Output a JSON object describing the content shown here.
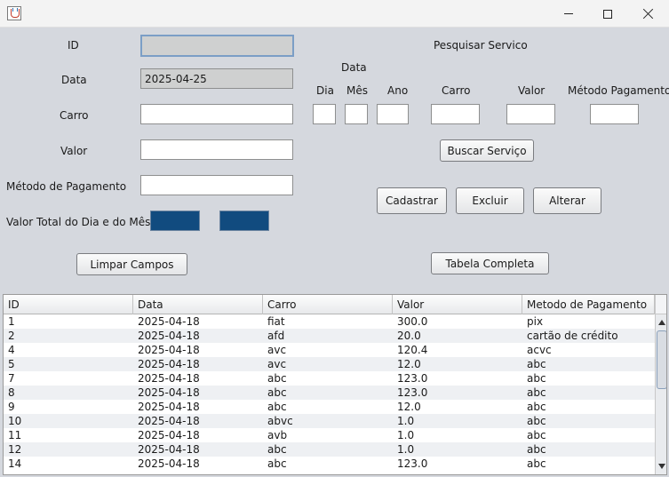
{
  "window": {
    "icon": "java-cup-icon",
    "controls": {
      "minimize": "minimize-icon",
      "maximize": "maximize-icon",
      "close": "close-icon"
    }
  },
  "form": {
    "id_label": "ID",
    "id_value": "",
    "data_label": "Data",
    "data_value": "2025-04-25",
    "carro_label": "Carro",
    "carro_value": "",
    "valor_label": "Valor",
    "valor_value": "",
    "metodo_label": "Método de Pagamento",
    "metodo_value": "",
    "total_label": "Valor Total do Dia e do Mês",
    "total_colors": [
      "#114b7f",
      "#114b7f"
    ]
  },
  "search": {
    "title": "Pesquisar Servico",
    "data_group_label": "Data",
    "dia_label": "Dia",
    "mes_label": "Mês",
    "ano_label": "Ano",
    "carro_label": "Carro",
    "valor_label": "Valor",
    "metodo_label": "Método Pagamento",
    "buscar_button": "Buscar Serviço"
  },
  "buttons": {
    "cadastrar": "Cadastrar",
    "excluir": "Excluir",
    "alterar": "Alterar",
    "limpar": "Limpar Campos",
    "tabela": "Tabela Completa"
  },
  "table": {
    "columns": [
      "ID",
      "Data",
      "Carro",
      "Valor",
      "Metodo de Pagamento"
    ],
    "rows": [
      [
        "1",
        "2025-04-18",
        "fiat",
        "300.0",
        "pix"
      ],
      [
        "2",
        "2025-04-18",
        "afd",
        "20.0",
        "cartão de crédito"
      ],
      [
        "4",
        "2025-04-18",
        "avc",
        "120.4",
        "acvc"
      ],
      [
        "5",
        "2025-04-18",
        "avc",
        "12.0",
        "abc"
      ],
      [
        "7",
        "2025-04-18",
        "abc",
        "123.0",
        "abc"
      ],
      [
        "8",
        "2025-04-18",
        "abc",
        "123.0",
        "abc"
      ],
      [
        "9",
        "2025-04-18",
        "abc",
        "12.0",
        "abc"
      ],
      [
        "10",
        "2025-04-18",
        "abvc",
        "1.0",
        "abc"
      ],
      [
        "11",
        "2025-04-18",
        "avb",
        "1.0",
        "abc"
      ],
      [
        "12",
        "2025-04-18",
        "abc",
        "1.0",
        "abc"
      ],
      [
        "14",
        "2025-04-18",
        "abc",
        "123.0",
        "abc"
      ]
    ]
  }
}
